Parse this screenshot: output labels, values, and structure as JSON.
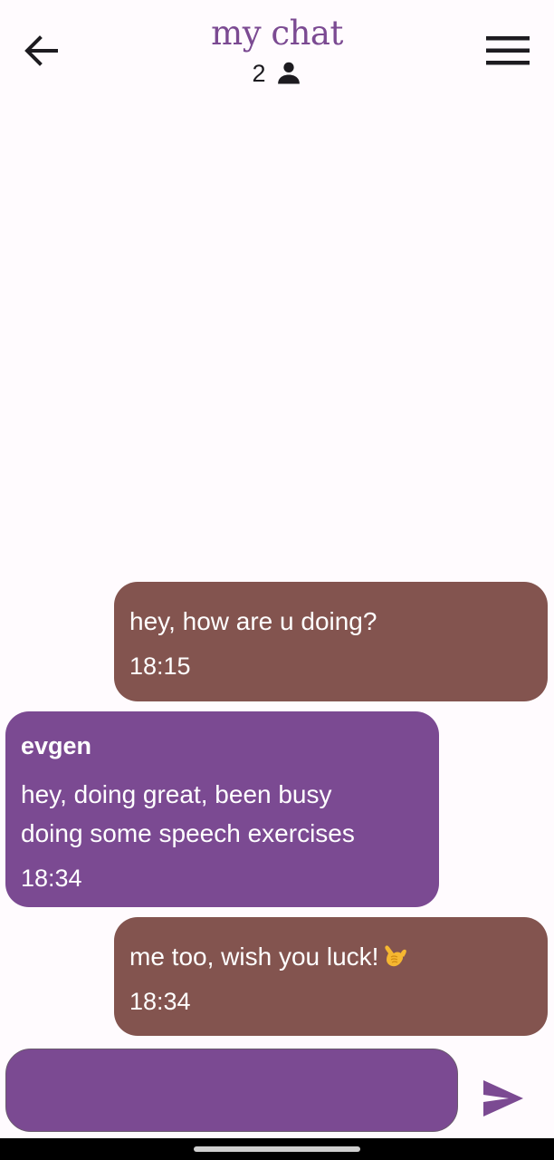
{
  "header": {
    "title": "my chat",
    "member_count": "2",
    "icons": {
      "back": "arrow-back-icon",
      "menu": "hamburger-menu-icon",
      "members": "person-icon"
    }
  },
  "messages": [
    {
      "direction": "outgoing",
      "text": "hey, how are u doing?",
      "time": "18:15"
    },
    {
      "direction": "incoming",
      "sender": "evgen",
      "text_line1": "hey, doing great, been busy",
      "text_line2": "doing some speech exercises",
      "time": "18:34"
    },
    {
      "direction": "outgoing",
      "text": "me too, wish you luck!",
      "emoji": "call-me-hand-emoji",
      "time": "18:34"
    }
  ],
  "composer": {
    "value": "",
    "placeholder": "",
    "send_icon": "send-icon"
  },
  "colors": {
    "accent": "#7b4a92",
    "outgoing_bubble": "#83544f",
    "incoming_bubble": "#7b4a92",
    "background": "#fffbfe",
    "icon_dark": "#1d1b20"
  }
}
